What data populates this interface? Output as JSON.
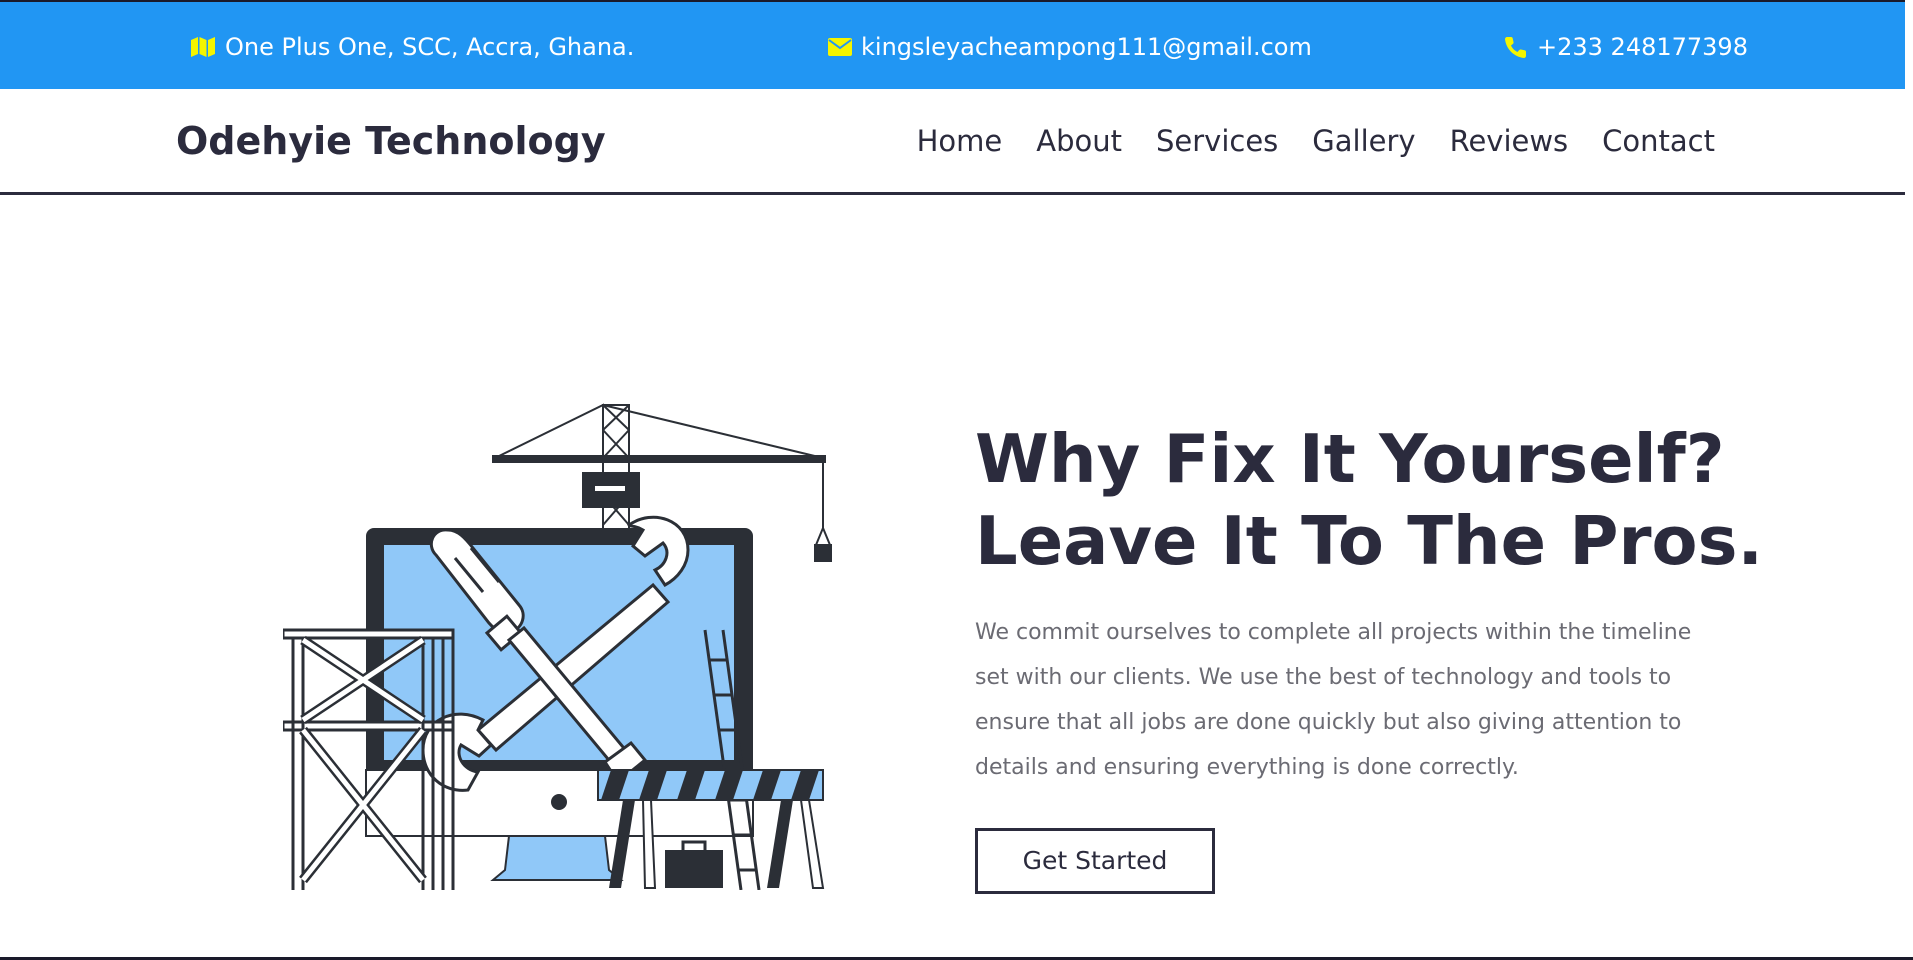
{
  "topbar": {
    "address": "One Plus One, SCC, Accra, Ghana.",
    "email": "kingsleyacheampong111@gmail.com",
    "phone": "+233 248177398",
    "icons": {
      "address": "map-icon",
      "email": "envelope-icon",
      "phone": "phone-icon"
    }
  },
  "navbar": {
    "brand": "Odehyie Technology",
    "links": [
      "Home",
      "About",
      "Services",
      "Gallery",
      "Reviews",
      "Contact"
    ]
  },
  "hero": {
    "title_line1": "Why Fix It Yourself?",
    "title_line2": "Leave It To The Pros.",
    "description": "We commit ourselves to complete all projects within the timeline set with our clients. We use the best of technology and tools to ensure that all jobs are done quickly but also giving attention to details and ensuring everything is done correctly.",
    "cta": "Get Started"
  },
  "colors": {
    "topbar_bg": "#2196f3",
    "icon_yellow": "#f5f500",
    "text_dark": "#2b2b3d",
    "text_muted": "#6b6b73",
    "screen_blue": "#90c8f8"
  }
}
